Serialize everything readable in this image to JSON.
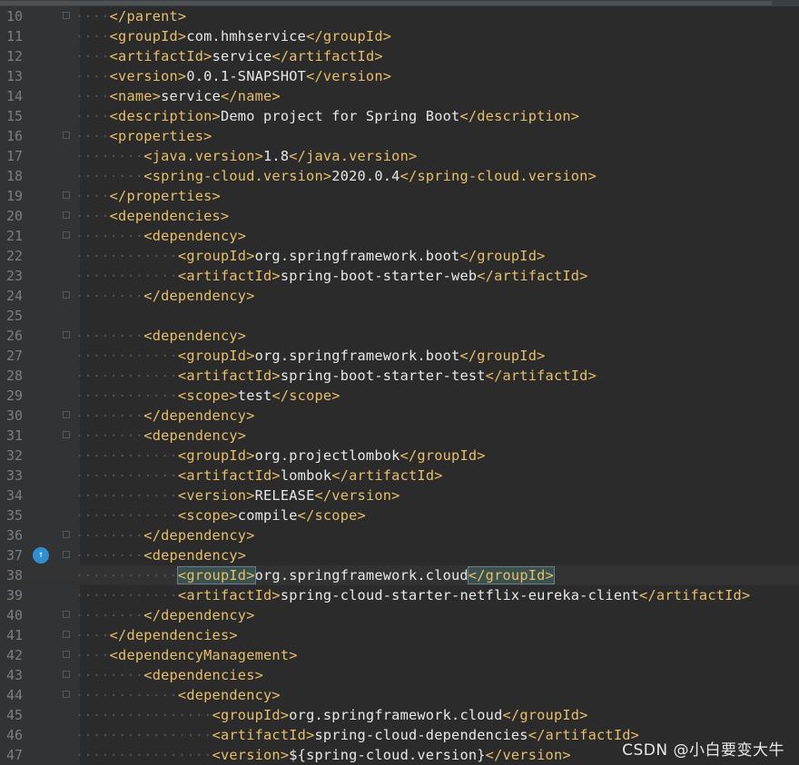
{
  "editor": {
    "lines": [
      {
        "num": "10",
        "text": "    </parent>"
      },
      {
        "num": "11",
        "text": "    <groupId>com.hmhservice</groupId>"
      },
      {
        "num": "12",
        "text": "    <artifactId>service</artifactId>"
      },
      {
        "num": "13",
        "text": "    <version>0.0.1-SNAPSHOT</version>"
      },
      {
        "num": "14",
        "text": "    <name>service</name>"
      },
      {
        "num": "15",
        "text": "    <description>Demo project for Spring Boot</description>"
      },
      {
        "num": "16",
        "text": "    <properties>"
      },
      {
        "num": "17",
        "text": "        <java.version>1.8</java.version>"
      },
      {
        "num": "18",
        "text": "        <spring-cloud.version>2020.0.4</spring-cloud.version>"
      },
      {
        "num": "19",
        "text": "    </properties>"
      },
      {
        "num": "20",
        "text": "    <dependencies>"
      },
      {
        "num": "21",
        "text": "        <dependency>"
      },
      {
        "num": "22",
        "text": "            <groupId>org.springframework.boot</groupId>"
      },
      {
        "num": "23",
        "text": "            <artifactId>spring-boot-starter-web</artifactId>"
      },
      {
        "num": "24",
        "text": "        </dependency>"
      },
      {
        "num": "25",
        "text": ""
      },
      {
        "num": "26",
        "text": "        <dependency>"
      },
      {
        "num": "27",
        "text": "            <groupId>org.springframework.boot</groupId>"
      },
      {
        "num": "28",
        "text": "            <artifactId>spring-boot-starter-test</artifactId>"
      },
      {
        "num": "29",
        "text": "            <scope>test</scope>"
      },
      {
        "num": "30",
        "text": "        </dependency>"
      },
      {
        "num": "31",
        "text": "        <dependency>"
      },
      {
        "num": "32",
        "text": "            <groupId>org.projectlombok</groupId>"
      },
      {
        "num": "33",
        "text": "            <artifactId>lombok</artifactId>"
      },
      {
        "num": "34",
        "text": "            <version>RELEASE</version>"
      },
      {
        "num": "35",
        "text": "            <scope>compile</scope>"
      },
      {
        "num": "36",
        "text": "        </dependency>"
      },
      {
        "num": "37",
        "text": "        <dependency>"
      },
      {
        "num": "38",
        "text": "            <groupId>org.springframework.cloud</groupId>"
      },
      {
        "num": "39",
        "text": "            <artifactId>spring-cloud-starter-netflix-eureka-client</artifactId>"
      },
      {
        "num": "40",
        "text": "        </dependency>"
      },
      {
        "num": "41",
        "text": "    </dependencies>"
      },
      {
        "num": "42",
        "text": "    <dependencyManagement>"
      },
      {
        "num": "43",
        "text": "        <dependencies>"
      },
      {
        "num": "44",
        "text": "            <dependency>"
      },
      {
        "num": "45",
        "text": "                <groupId>org.springframework.cloud</groupId>"
      },
      {
        "num": "46",
        "text": "                <artifactId>spring-cloud-dependencies</artifactId>"
      },
      {
        "num": "47",
        "text": "                <version>${spring-cloud.version}</version>"
      }
    ],
    "current_line": "38",
    "gutter_icon_line": "37",
    "gutter_icon": "override-up-arrow-icon"
  },
  "colors": {
    "background": "#2b2b2b",
    "gutter": "#313335",
    "line_number": "#7a7e85",
    "tag": "#e8bf6a",
    "text": "#e8e8e8",
    "current_line": "#323232",
    "gutter_icon": "#2f8fd0"
  },
  "watermark": "CSDN @小白要变大牛"
}
